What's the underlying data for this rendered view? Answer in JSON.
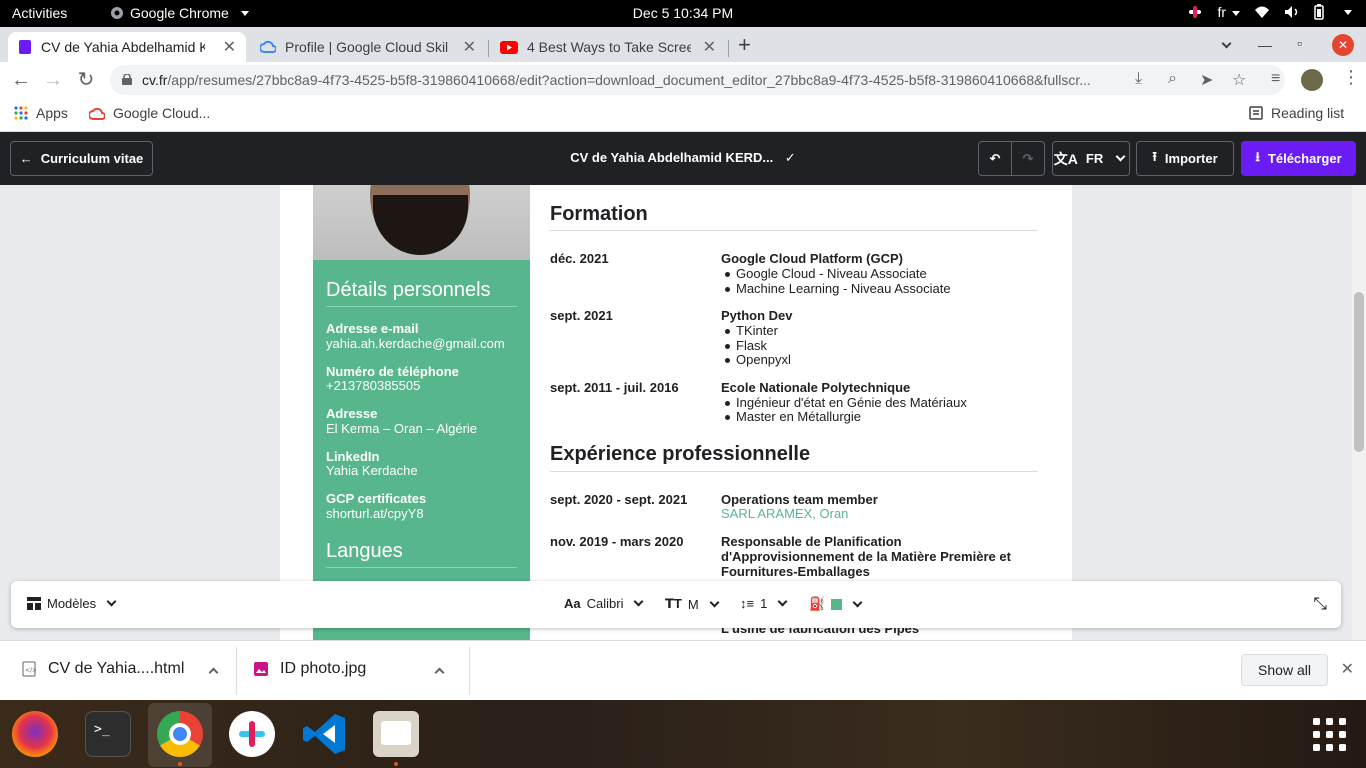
{
  "system": {
    "activities": "Activities",
    "app_name": "Google Chrome",
    "clock": "Dec 5  10:34 PM",
    "language": "fr"
  },
  "browser": {
    "tabs": [
      {
        "title": "CV de Yahia Abdelhamid K",
        "active": true
      },
      {
        "title": "Profile | Google Cloud Skil",
        "active": false
      },
      {
        "title": "4 Best Ways to Take Scree",
        "active": false
      }
    ],
    "url_domain": "cv.fr",
    "url_path": "/app/resumes/27bbc8a9-4f73-4525-b5f8-319860410668/edit?action=download_document_editor_27bbc8a9-4f73-4525-b5f8-319860410668&fullscr...",
    "bookmarks": [
      {
        "label": "Apps"
      },
      {
        "label": "Google Cloud..."
      }
    ],
    "reading_list": "Reading list"
  },
  "app_header": {
    "back_label": "Curriculum vitae",
    "doc_title": "CV de Yahia Abdelhamid KERD...",
    "language": "FR",
    "import_label": "Importer",
    "download_label": "Télécharger"
  },
  "resume": {
    "sidebar": {
      "personal_heading": "Détails personnels",
      "fields": [
        {
          "label": "Adresse e-mail",
          "value": "yahia.ah.kerdache@gmail.com"
        },
        {
          "label": "Numéro de téléphone",
          "value": "+213780385505"
        },
        {
          "label": "Adresse",
          "value": "El Kerma – Oran – Algérie"
        },
        {
          "label": "LinkedIn",
          "value": "Yahia Kerdache"
        },
        {
          "label": "GCP certificates",
          "value": "shorturl.at/cpyY8"
        }
      ],
      "languages_heading": "Langues"
    },
    "formation_heading": "Formation",
    "formation": [
      {
        "date": "déc. 2021",
        "title": "Google Cloud Platform (GCP)",
        "bullets": [
          "Google Cloud - Niveau Associate",
          "Machine Learning - Niveau Associate"
        ]
      },
      {
        "date": "sept. 2021",
        "title": "Python Dev",
        "bullets": [
          "TKinter",
          "Flask",
          "Openpyxl"
        ]
      },
      {
        "date": "sept. 2011 - juil. 2016",
        "title": "Ecole Nationale Polytechnique",
        "bullets": [
          "Ingénieur d'état en Génie des Matériaux",
          "Master en Métallurgie"
        ]
      }
    ],
    "experience_heading": "Expérience professionnelle",
    "experience": [
      {
        "date": "sept. 2020 - sept. 2021",
        "title": "Operations team member",
        "employer": "SARL ARAMEX, Oran"
      },
      {
        "date": "nov. 2019 - mars 2020",
        "title": "Responsable de Planification d'Approvisionnement de la Matière Première et Fournitures-Emballages",
        "employer": ""
      }
    ],
    "partial_line": "L'usine de fabrication des Pipes"
  },
  "format_bar": {
    "templates": "Modèles",
    "font": "Calibri",
    "size": "M",
    "spacing": "1",
    "color": "#58b68d"
  },
  "downloads": {
    "items": [
      {
        "name": "CV de Yahia....html"
      },
      {
        "name": "ID photo.jpg"
      }
    ],
    "show_all": "Show all"
  }
}
